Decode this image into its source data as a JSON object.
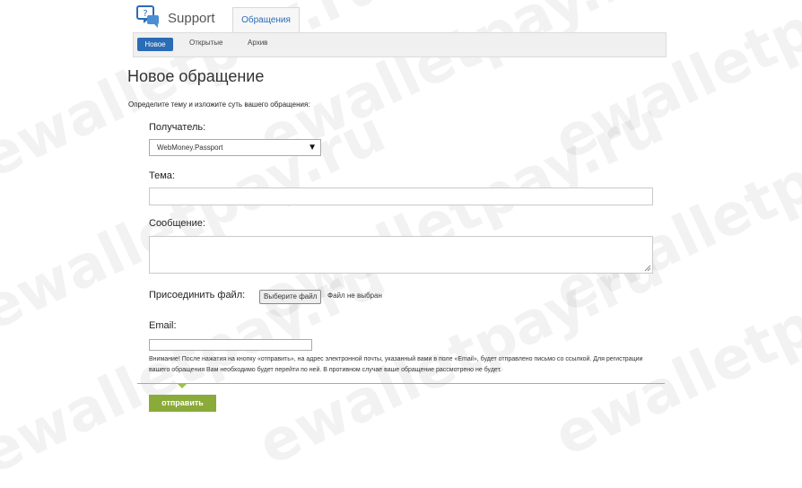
{
  "app": {
    "brand": "Support"
  },
  "top_tab": {
    "label": "Обращения"
  },
  "subnav": {
    "items": [
      {
        "label": "Новое"
      },
      {
        "label": "Открытые"
      },
      {
        "label": "Архив"
      }
    ]
  },
  "page": {
    "title": "Новое обращение",
    "intro": "Определите тему и изложите суть вашего обращения:"
  },
  "form": {
    "recipient_label": "Получатель:",
    "recipient_value": "WebMoney.Passport",
    "subject_label": "Тема:",
    "message_label": "Сообщение:",
    "attach_label": "Присоединить файл:",
    "file_button": "Выберите файл",
    "file_status": "Файл не выбран",
    "email_label": "Email:",
    "notice": "Внимание! После нажатия на кнопку «отправить», на адрес электронной почты, указанный вами в поле «Email», будет отправлено письмо со ссылкой. Для регистрации вашего обращения Вам необходимо будет перейти по ней. В противном случае ваше обращение рассмотрено не будет.",
    "submit": "отправить"
  },
  "watermark": "ewalletpay.ru",
  "colors": {
    "accent": "#2a6cb5",
    "submit": "#8aab3a",
    "divider": "#9fc04a"
  },
  "icons": {
    "logo": "chat-question-icon",
    "dropdown": "caret-down-icon"
  }
}
